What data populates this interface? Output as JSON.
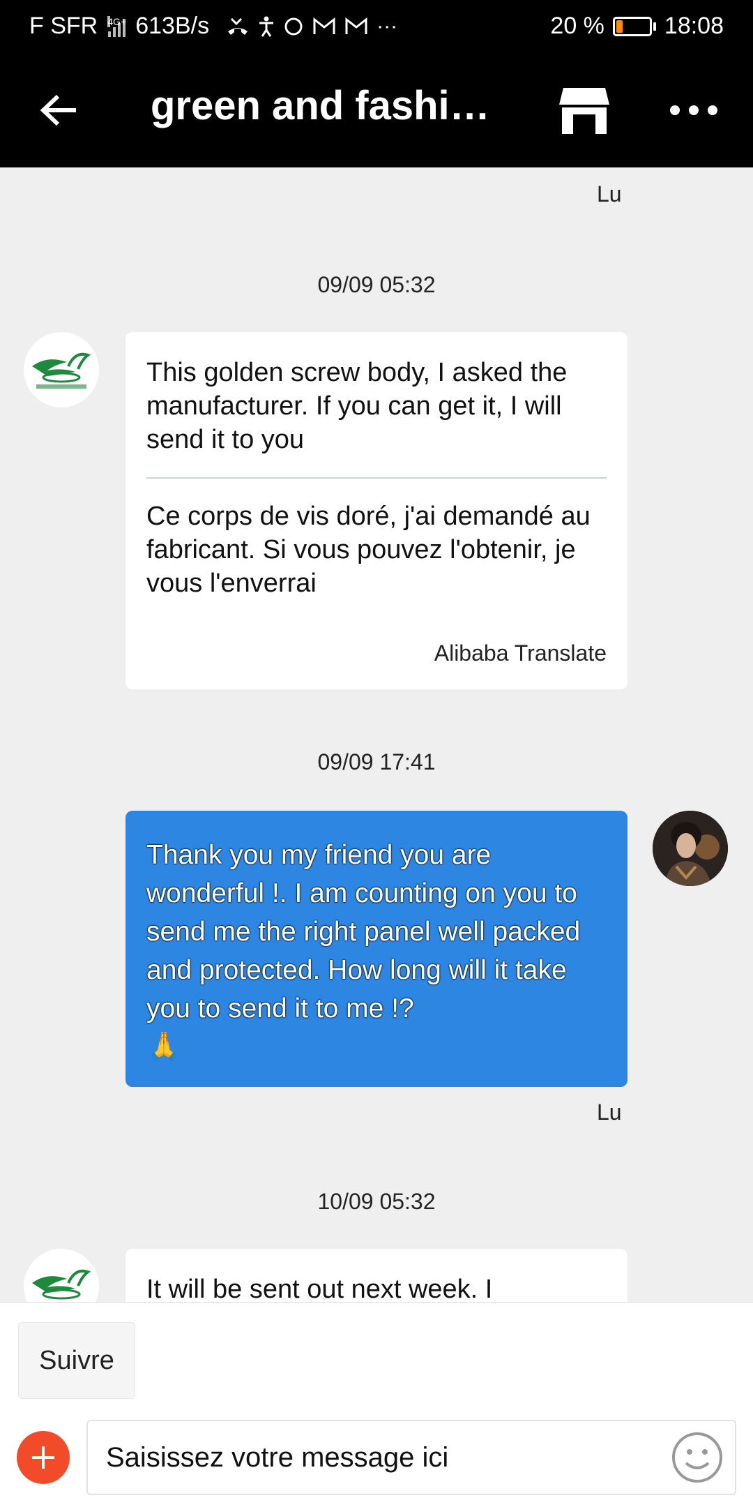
{
  "status_bar": {
    "carrier": "F SFR",
    "network": "4G+",
    "speed": "613B/s",
    "battery_percent": "20 %",
    "battery_level": 0.2,
    "time": "18:08"
  },
  "header": {
    "title": "green and fashio…",
    "icons": [
      "back-arrow-icon",
      "store-icon",
      "more-icon"
    ]
  },
  "messages": [
    {
      "type": "sender_label",
      "text": "Lu"
    },
    {
      "type": "timestamp",
      "text": "09/09 05:32"
    },
    {
      "type": "incoming",
      "original": "This golden screw body, I asked the manufacturer. If you can get it, I will send it to you",
      "translation": "Ce corps de vis doré, j'ai demandé au fabricant. Si vous pouvez l'obtenir, je vous l'enverrai",
      "translate_label": "Alibaba Translate"
    },
    {
      "type": "timestamp",
      "text": "09/09 17:41"
    },
    {
      "type": "outgoing",
      "text": "Thank you my friend you are wonderful !.  I am counting on you to send me the right panel well packed and protected.  How long will it take you to send it to me !?",
      "emoji": "🙏",
      "sender": "Lu"
    },
    {
      "type": "timestamp",
      "text": "10/09 05:32"
    },
    {
      "type": "incoming",
      "original": "It will be sent out next week. I"
    }
  ],
  "bottom_bar": {
    "follow_label": "Suivre",
    "input_placeholder": "Saisissez votre message ici",
    "input_value": ""
  },
  "colors": {
    "outgoing_bubble": "#2d86e2",
    "plus_button": "#f24b2a",
    "battery_fill": "#ff8a00",
    "logo_green": "#1e8a3c"
  }
}
